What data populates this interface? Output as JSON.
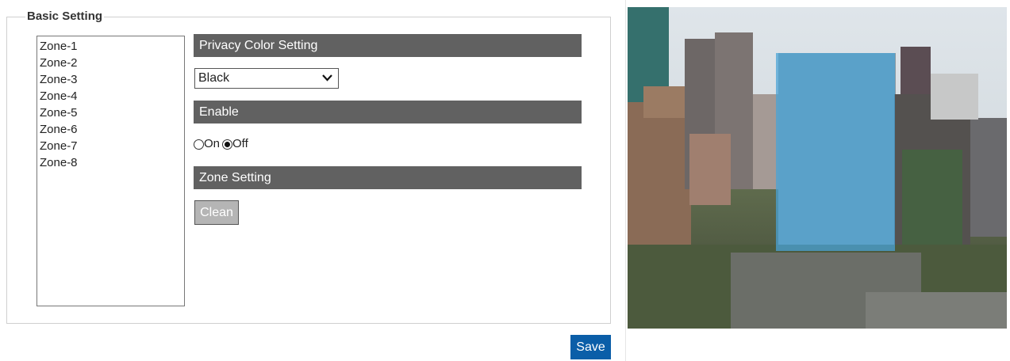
{
  "basic_setting": {
    "legend": "Basic Setting"
  },
  "zones": [
    "Zone-1",
    "Zone-2",
    "Zone-3",
    "Zone-4",
    "Zone-5",
    "Zone-6",
    "Zone-7",
    "Zone-8"
  ],
  "privacy_color": {
    "header": "Privacy Color Setting",
    "selected": "Black"
  },
  "enable": {
    "header": "Enable",
    "on_label": "On",
    "off_label": "Off",
    "selected": "Off"
  },
  "zone_setting": {
    "header": "Zone Setting",
    "clean_label": "Clean"
  },
  "save_label": "Save",
  "colors": {
    "section_bar": "#616161",
    "save_button": "#0b5ea8",
    "privacy_mask": "#4aa3d6"
  },
  "camera_preview": {
    "icon": "camera-preview",
    "privacy_mask_shown": true
  }
}
